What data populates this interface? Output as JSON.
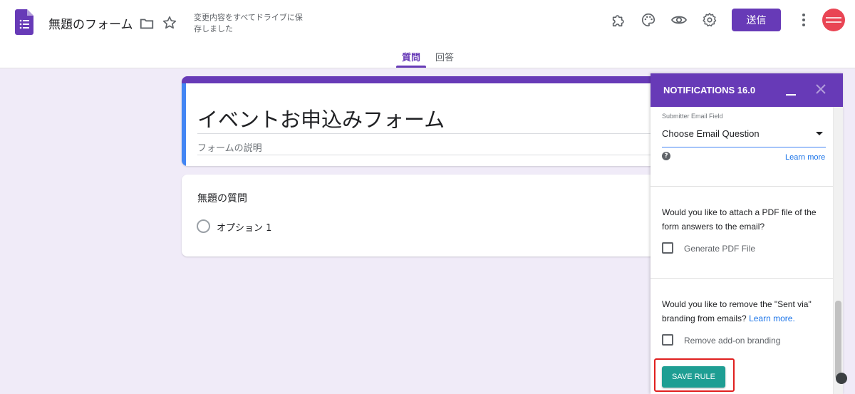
{
  "header": {
    "doc_title": "無題のフォーム",
    "save_status": "変更内容をすべてドライブに保存しました",
    "send_label": "送信",
    "icons": [
      "forms-logo-icon",
      "folder-icon",
      "star-icon",
      "addon-icon",
      "palette-icon",
      "eye-icon",
      "gear-icon",
      "more-vert-icon"
    ]
  },
  "tabs": [
    {
      "label": "質問",
      "active": true
    },
    {
      "label": "回答",
      "active": false
    }
  ],
  "form": {
    "title": "イベントお申込みフォーム",
    "description_placeholder": "フォームの説明",
    "question_title": "無題の質問",
    "option_label": "オプション 1"
  },
  "sidebar": {
    "title": "NOTIFICATIONS 16.0",
    "email_field_label": "Submitter Email Field",
    "email_field_value": "Choose Email Question",
    "help_glyph": "?",
    "learn_more": "Learn more",
    "pdf_question": "Would you like to attach a PDF file of the form answers to the email?",
    "pdf_checkbox_label": "Generate PDF File",
    "branding_question": "Would you like to remove the \"Sent via\" branding from emails?",
    "branding_link": "Learn more.",
    "branding_checkbox_label": "Remove add-on branding",
    "save_rule_label": "SAVE RULE"
  },
  "colors": {
    "brand_purple": "#673ab7",
    "background": "#f0ebf8",
    "save_button": "#1e9e93",
    "highlight_red": "#e0201f",
    "link_blue": "#1a73e8"
  }
}
